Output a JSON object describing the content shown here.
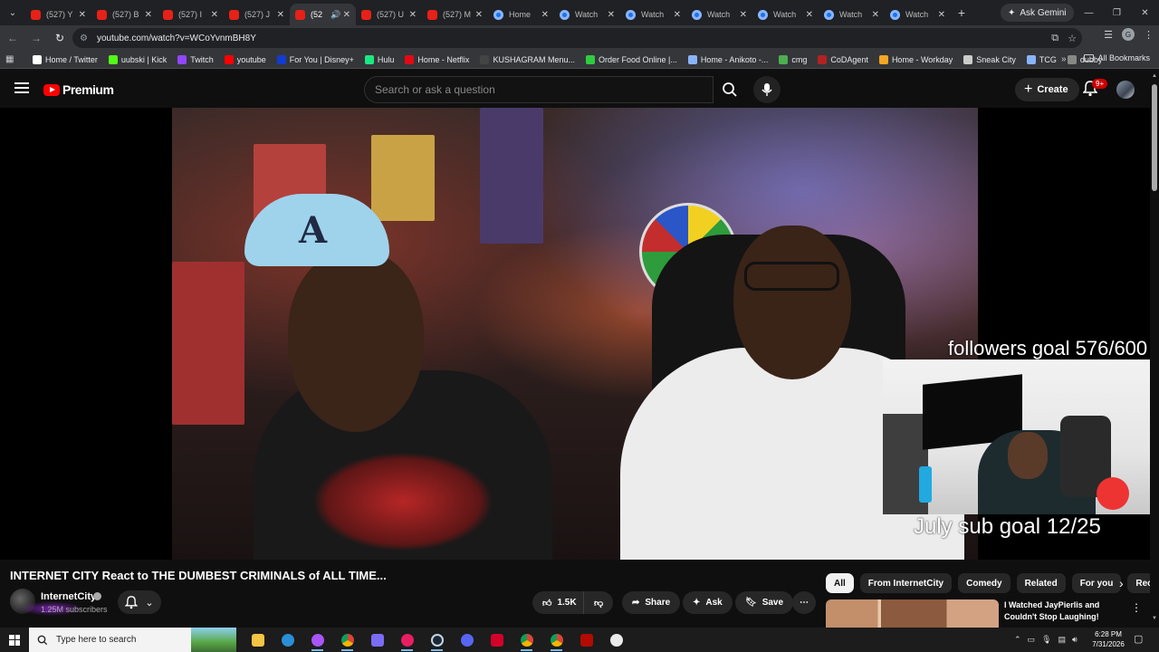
{
  "browser": {
    "tabs": [
      {
        "title": "(527) Y",
        "type": "youtube"
      },
      {
        "title": "(527) B",
        "type": "youtube"
      },
      {
        "title": "(527) I",
        "type": "youtube"
      },
      {
        "title": "(527) J",
        "type": "youtube"
      },
      {
        "title": "(52",
        "type": "youtube",
        "active": true,
        "audio": "🔊"
      },
      {
        "title": "(527) U",
        "type": "youtube"
      },
      {
        "title": "(527) M",
        "type": "youtube"
      },
      {
        "title": "Home",
        "type": "globe"
      },
      {
        "title": "Watch",
        "type": "globe"
      },
      {
        "title": "Watch",
        "type": "globe"
      },
      {
        "title": "Watch",
        "type": "globe"
      },
      {
        "title": "Watch",
        "type": "globe"
      },
      {
        "title": "Watch",
        "type": "globe"
      },
      {
        "title": "Watch",
        "type": "globe"
      }
    ],
    "new_tab": "+",
    "ask_gemini": "Ask Gemini",
    "url": "youtube.com/watch?v=WCoYvnmBH8Y",
    "profile_initial": "G",
    "bookmarks": [
      {
        "label": "Home / Twitter",
        "color": "#ffffff"
      },
      {
        "label": "uubski | Kick",
        "color": "#53fc18"
      },
      {
        "label": "Twitch",
        "color": "#9146ff"
      },
      {
        "label": "youtube",
        "color": "#ff0000"
      },
      {
        "label": "For You | Disney+",
        "color": "#113ccf"
      },
      {
        "label": "Hulu",
        "color": "#1ce783"
      },
      {
        "label": "Home - Netflix",
        "color": "#e50914"
      },
      {
        "label": "KUSHAGRAM Menu...",
        "color": "#444444"
      },
      {
        "label": "Order Food Online |...",
        "color": "#2ecc40"
      },
      {
        "label": "Home - Anikoto -...",
        "color": "#8ab4f8"
      },
      {
        "label": "cmg",
        "color": "#4caf50"
      },
      {
        "label": "CoDAgent",
        "color": "#b22222"
      },
      {
        "label": "Home - Workday",
        "color": "#f5a623"
      },
      {
        "label": "Sneak City",
        "color": "#cccccc"
      },
      {
        "label": "TCG",
        "color": "#8ab4f8"
      },
      {
        "label": "dubby",
        "color": "#888888"
      }
    ],
    "bookmarks_more": "»",
    "all_bookmarks": "All Bookmarks"
  },
  "youtube": {
    "logo_text": "Premium",
    "search_placeholder": "Search or ask a question",
    "create_label": "Create",
    "notif_badge": "9+",
    "video": {
      "overlay_top": "followers goal 576/600",
      "overlay_bottom": "July sub goal 12/25"
    },
    "title": "INTERNET CITY React to THE DUMBEST CRIMINALS of ALL TIME...",
    "channel": "InternetCity",
    "subscribers": "1.25M subscribers",
    "actions": {
      "likes": "1.5K",
      "share": "Share",
      "ask": "Ask",
      "save": "Save",
      "more": "⋯"
    },
    "chips": [
      "All",
      "From InternetCity",
      "Comedy",
      "Related",
      "For you",
      "Rec"
    ],
    "recommended": {
      "title": "I Watched JayPierlis and Couldn't Stop Laughing!"
    }
  },
  "taskbar": {
    "search_placeholder": "Type here to search",
    "time": "6:28 PM",
    "date": "7/31/2026"
  }
}
